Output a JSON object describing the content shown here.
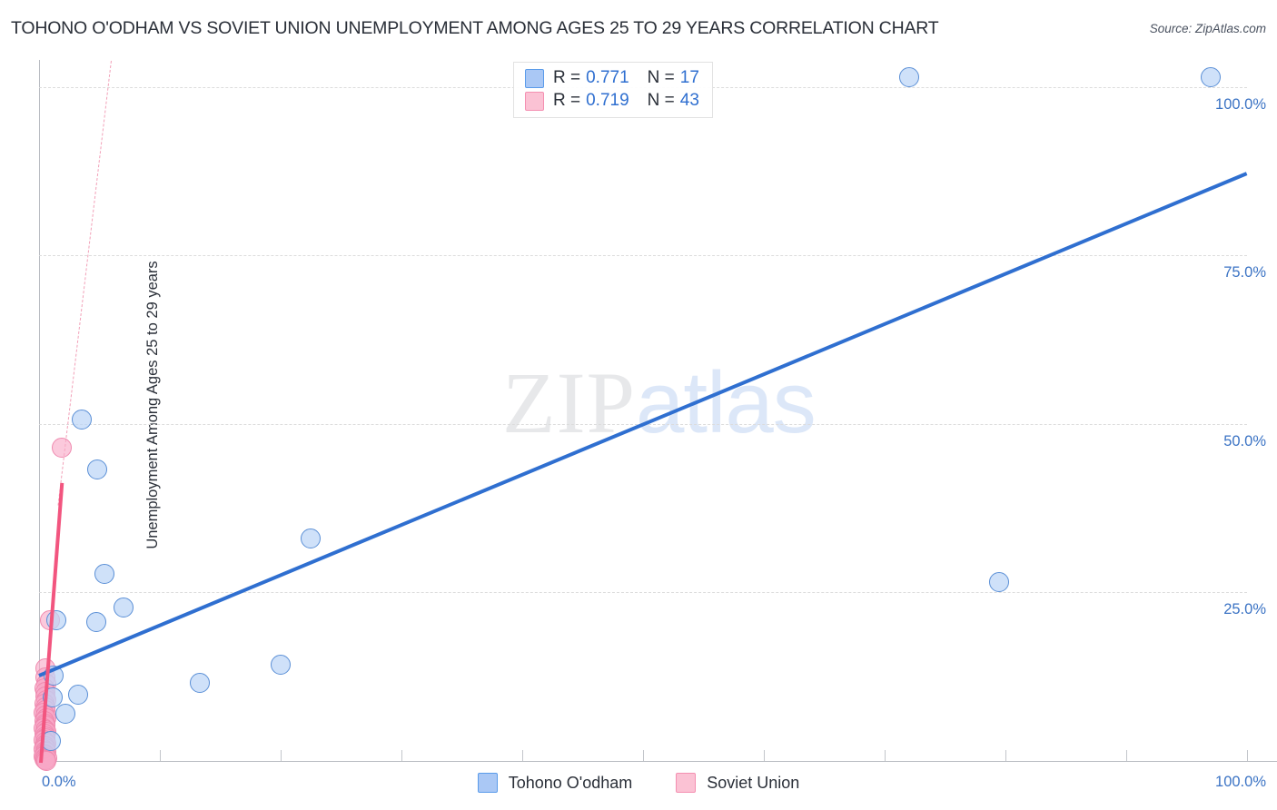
{
  "header": {
    "title": "TOHONO O'ODHAM VS SOVIET UNION UNEMPLOYMENT AMONG AGES 25 TO 29 YEARS CORRELATION CHART",
    "source": "Source: ZipAtlas.com"
  },
  "watermark": {
    "part1": "ZIP",
    "part2": "atlas"
  },
  "stats": {
    "rows": [
      {
        "series": "Tohono O'odham",
        "color": "#aac8f5",
        "r_label": "R =",
        "r_value": "0.771",
        "n_label": "N =",
        "n_value": "17"
      },
      {
        "series": "Soviet Union",
        "color": "#fbc2d4",
        "r_label": "R =",
        "r_value": "0.719",
        "n_label": "N =",
        "n_value": "43"
      }
    ]
  },
  "legend": {
    "items": [
      {
        "label": "Tohono O'odham",
        "color": "#aac8f5",
        "border": "#5a9bea"
      },
      {
        "label": "Soviet Union",
        "color": "#fbc2d4",
        "border": "#f48fb1"
      }
    ]
  },
  "chart_data": {
    "type": "scatter",
    "title": "TOHONO O'ODHAM VS SOVIET UNION UNEMPLOYMENT AMONG AGES 25 TO 29 YEARS CORRELATION CHART",
    "xlabel": "",
    "ylabel": "Unemployment Among Ages 25 to 29 years",
    "xlim": [
      0,
      100
    ],
    "ylim": [
      0,
      104
    ],
    "grid": true,
    "legend_position": "bottom-center",
    "x_ticks": [
      "0.0%",
      "100.0%"
    ],
    "x_tick_values": [
      0,
      100
    ],
    "y_ticks": [
      "25.0%",
      "50.0%",
      "75.0%",
      "100.0%"
    ],
    "y_tick_values": [
      25,
      50,
      75,
      100
    ],
    "series": [
      {
        "name": "Tohono O'odham",
        "color": "#bcd6f6",
        "border": "#5a8fd6",
        "r": 0.771,
        "n": 17,
        "trendline": {
          "type": "linear",
          "x0": 0,
          "y0": 13.0,
          "x1": 100,
          "y1": 87.5,
          "color": "#2f6fd0"
        },
        "points": [
          {
            "x": 72.0,
            "y": 101.5,
            "r": 11
          },
          {
            "x": 97.0,
            "y": 101.5,
            "r": 11
          },
          {
            "x": 3.5,
            "y": 50.6,
            "r": 11
          },
          {
            "x": 4.8,
            "y": 43.3,
            "r": 11
          },
          {
            "x": 22.5,
            "y": 33.0,
            "r": 11
          },
          {
            "x": 79.5,
            "y": 26.6,
            "r": 11
          },
          {
            "x": 5.4,
            "y": 27.8,
            "r": 11
          },
          {
            "x": 7.0,
            "y": 22.8,
            "r": 11
          },
          {
            "x": 4.7,
            "y": 20.6,
            "r": 11
          },
          {
            "x": 1.4,
            "y": 20.9,
            "r": 11
          },
          {
            "x": 20.0,
            "y": 14.3,
            "r": 11
          },
          {
            "x": 13.3,
            "y": 11.6,
            "r": 11
          },
          {
            "x": 1.2,
            "y": 12.6,
            "r": 11
          },
          {
            "x": 3.2,
            "y": 9.8,
            "r": 11
          },
          {
            "x": 1.1,
            "y": 9.4,
            "r": 11
          },
          {
            "x": 2.2,
            "y": 7.0,
            "r": 11
          },
          {
            "x": 1.0,
            "y": 3.0,
            "r": 11
          }
        ]
      },
      {
        "name": "Soviet Union",
        "color": "#f9a8c7",
        "border": "#ef8aaf",
        "r": 0.719,
        "n": 43,
        "trendline": {
          "type": "linear",
          "x0": 0.15,
          "y0": 0.0,
          "x1": 1.9,
          "y1": 41.5,
          "color": "#f2557f"
        },
        "trendline_extension": {
          "x0": 1.6,
          "y0": 38.0,
          "x1": 6.0,
          "y1": 104.0,
          "color": "#f2a0b8",
          "style": "dashed"
        },
        "points": [
          {
            "x": 1.9,
            "y": 46.5,
            "r": 11
          },
          {
            "x": 0.9,
            "y": 20.9,
            "r": 11
          },
          {
            "x": 0.55,
            "y": 13.8,
            "r": 11
          },
          {
            "x": 0.5,
            "y": 12.4,
            "r": 11
          },
          {
            "x": 0.6,
            "y": 11.5,
            "r": 11
          },
          {
            "x": 0.45,
            "y": 10.8,
            "r": 11
          },
          {
            "x": 0.55,
            "y": 10.2,
            "r": 11
          },
          {
            "x": 0.5,
            "y": 9.6,
            "r": 11
          },
          {
            "x": 0.6,
            "y": 9.0,
            "r": 11
          },
          {
            "x": 0.45,
            "y": 8.5,
            "r": 11
          },
          {
            "x": 0.5,
            "y": 8.0,
            "r": 11
          },
          {
            "x": 0.55,
            "y": 7.5,
            "r": 11
          },
          {
            "x": 0.4,
            "y": 7.1,
            "r": 11
          },
          {
            "x": 0.5,
            "y": 6.7,
            "r": 11
          },
          {
            "x": 0.6,
            "y": 6.3,
            "r": 11
          },
          {
            "x": 0.45,
            "y": 5.9,
            "r": 11
          },
          {
            "x": 0.5,
            "y": 5.5,
            "r": 11
          },
          {
            "x": 0.55,
            "y": 5.2,
            "r": 11
          },
          {
            "x": 0.4,
            "y": 4.9,
            "r": 11
          },
          {
            "x": 0.5,
            "y": 4.6,
            "r": 11
          },
          {
            "x": 0.6,
            "y": 4.3,
            "r": 11
          },
          {
            "x": 0.45,
            "y": 4.0,
            "r": 11
          },
          {
            "x": 0.5,
            "y": 3.7,
            "r": 11
          },
          {
            "x": 0.55,
            "y": 3.4,
            "r": 11
          },
          {
            "x": 0.4,
            "y": 3.1,
            "r": 11
          },
          {
            "x": 0.5,
            "y": 2.8,
            "r": 11
          },
          {
            "x": 0.6,
            "y": 2.5,
            "r": 11
          },
          {
            "x": 0.45,
            "y": 2.3,
            "r": 11
          },
          {
            "x": 0.5,
            "y": 2.1,
            "r": 11
          },
          {
            "x": 0.55,
            "y": 1.9,
            "r": 11
          },
          {
            "x": 0.4,
            "y": 1.7,
            "r": 11
          },
          {
            "x": 0.5,
            "y": 1.5,
            "r": 11
          },
          {
            "x": 0.6,
            "y": 1.3,
            "r": 11
          },
          {
            "x": 0.45,
            "y": 1.1,
            "r": 11
          },
          {
            "x": 0.5,
            "y": 0.95,
            "r": 11
          },
          {
            "x": 0.55,
            "y": 0.8,
            "r": 11
          },
          {
            "x": 0.4,
            "y": 0.65,
            "r": 11
          },
          {
            "x": 0.5,
            "y": 0.5,
            "r": 11
          },
          {
            "x": 0.65,
            "y": 0.4,
            "r": 11
          },
          {
            "x": 0.45,
            "y": 0.3,
            "r": 11
          },
          {
            "x": 0.55,
            "y": 0.2,
            "r": 11
          },
          {
            "x": 0.5,
            "y": 0.12,
            "r": 11
          },
          {
            "x": 0.6,
            "y": 0.05,
            "r": 11
          }
        ]
      }
    ]
  }
}
